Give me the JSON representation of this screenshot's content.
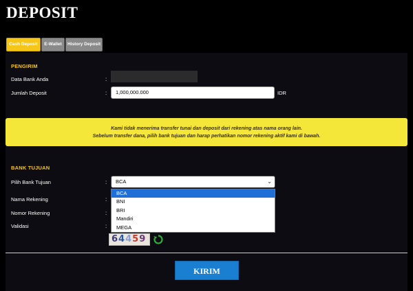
{
  "page": {
    "title": "DEPOSIT"
  },
  "tabs": [
    {
      "label": "Cash Deposit",
      "active": true
    },
    {
      "label": "E-Wallet",
      "active": false
    },
    {
      "label": "History Deposit",
      "active": false
    }
  ],
  "sender": {
    "section_title": "PENGIRIM",
    "bank_data_label": "Data Bank Anda",
    "amount_label": "Jumlah Deposit",
    "amount_value": "1,000,000.000",
    "currency": "IDR"
  },
  "notice": {
    "line1": "Kami tidak menerima transfer tunai dan deposit dari rekening atas nama orang lain.",
    "line2": "Sebelum transfer dana, pilih bank tujuan dan harap perhatikan nomor rekening aktif kami di bawah."
  },
  "destination": {
    "section_title": "BANK TUJUAN",
    "bank_label": "Pilih Bank Tujuan",
    "selected_bank": "BCA",
    "bank_options": [
      "BCA",
      "BNI",
      "BRI",
      "Mandiri",
      "MEGA"
    ],
    "account_name_label": "Nama Rekening",
    "account_number_label": "Nomor Rekening",
    "validation_label": "Validasi",
    "captcha_digits": [
      "6",
      "4",
      "4",
      "5",
      "9"
    ]
  },
  "actions": {
    "submit_label": "KIRIM"
  },
  "colors": {
    "accent": "#f5c518",
    "notice_bg": "#f5e63a",
    "submit_bg": "#1a7fd1",
    "selected_option": "#1f6fd6"
  },
  "icons": {
    "refresh": "refresh-icon",
    "dropdown": "chevron-down-icon"
  }
}
